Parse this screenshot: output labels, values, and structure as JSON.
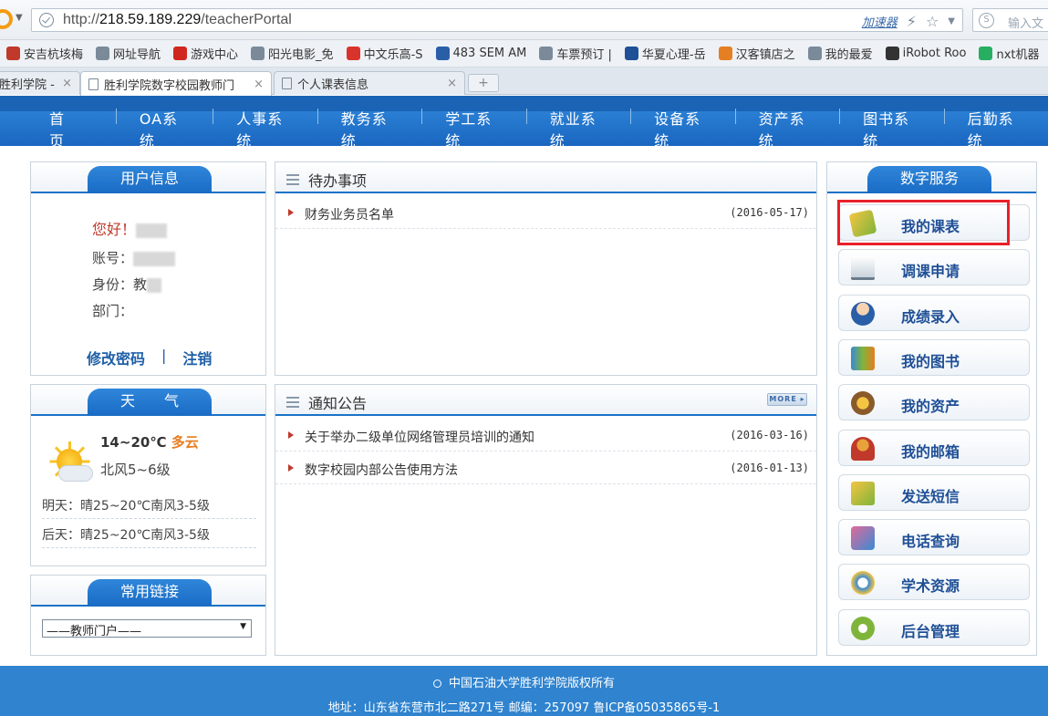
{
  "browser": {
    "url_prefix": "http://",
    "url_host": "218.59.189.229",
    "url_path": "/teacherPortal",
    "accelerator": "加速器",
    "search_placeholder": "输入文",
    "favorites": [
      {
        "label": "安吉杭垓梅",
        "color": "#c0392b"
      },
      {
        "label": "网址导航",
        "color": "#7a8a99"
      },
      {
        "label": "游戏中心",
        "color": "#d0281e"
      },
      {
        "label": "阳光电影_免",
        "color": "#7a8a99"
      },
      {
        "label": "中文乐高-S",
        "color": "#d9342b"
      },
      {
        "label": "483 SEM AM",
        "color": "#2a5fa8"
      },
      {
        "label": "车票预订 |",
        "color": "#7a8a99"
      },
      {
        "label": "华夏心理-岳",
        "color": "#1f4f96"
      },
      {
        "label": "汉客镇店之",
        "color": "#e67e22"
      },
      {
        "label": "我的最爱",
        "color": "#7a8a99"
      },
      {
        "label": "iRobot Roo",
        "color": "#333333"
      },
      {
        "label": "nxt机器",
        "color": "#27ae60"
      }
    ],
    "tabs": [
      {
        "label": "胜利学院 -"
      },
      {
        "label": "胜利学院数字校园教师门"
      },
      {
        "label": "个人课表信息"
      }
    ],
    "new_tab": "+"
  },
  "nav": {
    "items": [
      "首　页",
      "OA系统",
      "人事系统",
      "教务系统",
      "学工系统",
      "就业系统",
      "设备系统",
      "资产系统",
      "图书系统",
      "后勤系统"
    ]
  },
  "user_info": {
    "title": "用户信息",
    "greeting": "您好！",
    "account_label": "账号：",
    "identity_label": "身份：教",
    "department_label": "部门：",
    "change_password": "修改密码",
    "separator": "|",
    "logout": "注销"
  },
  "weather": {
    "title": "天　　气",
    "temp": "14~20℃",
    "condition": "多云",
    "wind": "北风5~6级",
    "tomorrow": "明天：晴25~20℃南风3-5级",
    "day_after": "后天：晴25~20℃南风3-5级"
  },
  "links": {
    "title": "常用链接",
    "selected": "——教师门户——"
  },
  "todo": {
    "title": "待办事项",
    "items": [
      {
        "text": "财务业务员名单",
        "date": "(2016-05-17)"
      }
    ]
  },
  "notice": {
    "title": "通知公告",
    "more": "MORE ▸",
    "items": [
      {
        "text": "关于举办二级单位网络管理员培训的通知",
        "date": "(2016-03-16)"
      },
      {
        "text": "数字校园内部公告使用方法",
        "date": "(2016-01-13)"
      }
    ]
  },
  "services": {
    "title": "数字服务",
    "items": [
      {
        "label": "我的课表",
        "icon": "schedule-icon"
      },
      {
        "label": "调课申请",
        "icon": "writing-icon"
      },
      {
        "label": "成绩录入",
        "icon": "teacher-icon"
      },
      {
        "label": "我的图书",
        "icon": "books-icon"
      },
      {
        "label": "我的资产",
        "icon": "assets-icon"
      },
      {
        "label": "我的邮箱",
        "icon": "medal-icon"
      },
      {
        "label": "发送短信",
        "icon": "message-icon"
      },
      {
        "label": "电话查询",
        "icon": "phone-icon"
      },
      {
        "label": "学术资源",
        "icon": "globe-icon"
      },
      {
        "label": "后台管理",
        "icon": "gear-icon"
      }
    ]
  },
  "footer": {
    "copyright": "中国石油大学胜利学院版权所有",
    "address": "地址：山东省东营市北二路271号 邮编：257097 鲁ICP备05035865号-1"
  },
  "colors": {
    "nav_blue": "#1a66c0",
    "service_text": "#1f4f96",
    "greeting_red": "#c0392b",
    "highlight_red": "#e8202a"
  }
}
